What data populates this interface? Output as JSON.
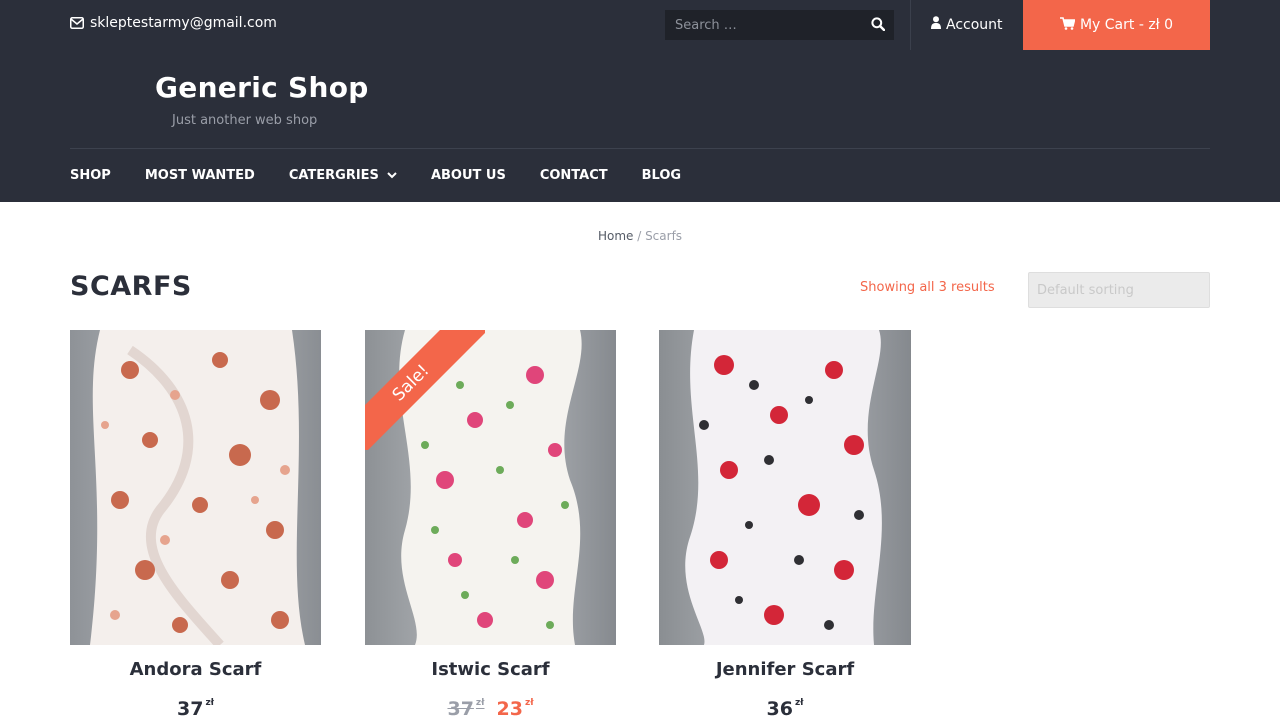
{
  "topbar": {
    "email": "skleptestarmy@gmail.com",
    "search_placeholder": "Search …",
    "account_label": "Account",
    "cart_label": "My Cart - zł 0"
  },
  "header": {
    "site_title": "Generic Shop",
    "tagline": "Just another web shop"
  },
  "nav": {
    "items": [
      "SHOP",
      "MOST WANTED",
      "CATERGRIES",
      "ABOUT US",
      "CONTACT",
      "BLOG"
    ]
  },
  "breadcrumb": {
    "home": "Home",
    "separator": " / ",
    "current": "Scarfs"
  },
  "page": {
    "title": "SCARFS",
    "result_count": "Showing all 3 results",
    "sorting": "Default sorting"
  },
  "products": [
    {
      "name": "Andora Scarf",
      "price": "37",
      "currency": "zł",
      "sale": false,
      "palette": "terracotta"
    },
    {
      "name": "Istwic Scarf",
      "old_price": "37",
      "price": "23",
      "currency": "zł",
      "sale": true,
      "sale_label": "Sale!",
      "palette": "pink-green"
    },
    {
      "name": "Jennifer Scarf",
      "price": "36",
      "currency": "zł",
      "sale": false,
      "palette": "red-black"
    }
  ],
  "colors": {
    "dark": "#2b2f3a",
    "accent": "#f3664a",
    "muted": "#9a9ea8"
  }
}
